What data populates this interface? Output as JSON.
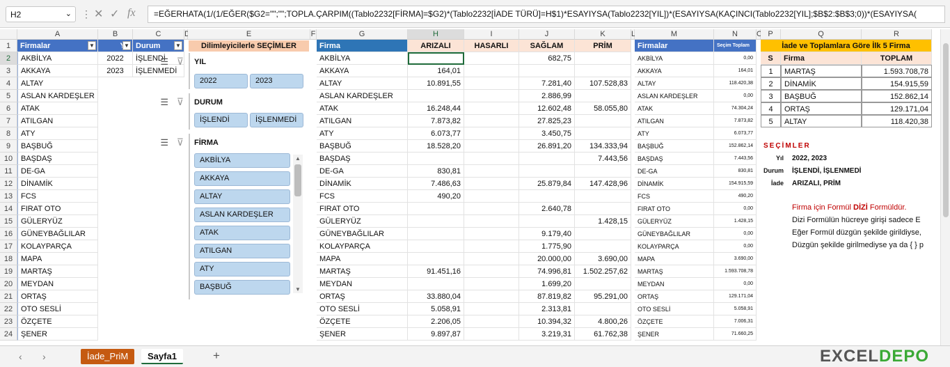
{
  "namebox": "H2",
  "formula": "=EĞERHATA(1/(1/EĞER($G2=\"\";\"\";TOPLA.ÇARPIM((Tablo2232[FİRMA]=$G2)*(Tablo2232[İADE TÜRÜ]=H$1)*ESAYIYSA(Tablo2232[YIL])*(ESAYIYSA(KAÇINCI(Tablo2232[YIL];$B$2:$B$3;0))*(ESAYIYSA(",
  "columns": [
    "A",
    "B",
    "C",
    "D",
    "E",
    "F",
    "G",
    "H",
    "I",
    "J",
    "K",
    "L",
    "M",
    "N",
    "O",
    "P",
    "Q",
    "R"
  ],
  "rows": [
    "1",
    "2",
    "3",
    "4",
    "5",
    "6",
    "7",
    "8",
    "9",
    "10",
    "11",
    "12",
    "13",
    "14",
    "15",
    "16",
    "17",
    "18",
    "19",
    "20",
    "21",
    "22",
    "23",
    "24"
  ],
  "tableA": {
    "header": "Firmalar",
    "items": [
      "AKBİLYA",
      "AKKAYA",
      "ALTAY",
      "ASLAN KARDEŞLER",
      "ATAK",
      "ATILGAN",
      "ATY",
      "BAŞBUĞ",
      "BAŞDAŞ",
      "DE-GA",
      "DİNAMİK",
      "FCS",
      "FIRAT OTO",
      "GÜLERYÜZ",
      "GÜNEYBAĞLILAR",
      "KOLAYPARÇA",
      "MAPA",
      "MARTAŞ",
      "MEYDAN",
      "ORTAŞ",
      "OTO SESLİ",
      "ÖZÇETE",
      "ŞENER"
    ]
  },
  "tableB": {
    "header": "Yıl",
    "items": [
      "2022",
      "2023"
    ]
  },
  "tableC": {
    "header": "Durum",
    "items": [
      "İŞLENDİ",
      "İŞLENMEDİ"
    ]
  },
  "slicer": {
    "header": "Dilimleyicilerle SEÇİMLER",
    "yil": {
      "title": "YIL",
      "items": [
        "2022",
        "2023"
      ]
    },
    "durum": {
      "title": "DURUM",
      "items": [
        "İŞLENDİ",
        "İŞLENMEDİ"
      ]
    },
    "firma": {
      "title": "FİRMA",
      "items": [
        "AKBİLYA",
        "AKKAYA",
        "ALTAY",
        "ASLAN KARDEŞLER",
        "ATAK",
        "ATILGAN",
        "ATY",
        "BAŞBUĞ"
      ]
    }
  },
  "mainTable": {
    "headers": [
      "Firma",
      "ARIZALI",
      "HASARLI",
      "SAĞLAM",
      "PRİM"
    ],
    "rows": [
      [
        "AKBİLYA",
        "",
        "",
        "682,75",
        ""
      ],
      [
        "AKKAYA",
        "164,01",
        "",
        "",
        ""
      ],
      [
        "ALTAY",
        "10.891,55",
        "",
        "7.281,40",
        "107.528,83"
      ],
      [
        "ASLAN KARDEŞLER",
        "",
        "",
        "2.886,99",
        ""
      ],
      [
        "ATAK",
        "16.248,44",
        "",
        "12.602,48",
        "58.055,80"
      ],
      [
        "ATILGAN",
        "7.873,82",
        "",
        "27.825,23",
        ""
      ],
      [
        "ATY",
        "6.073,77",
        "",
        "3.450,75",
        ""
      ],
      [
        "BAŞBUĞ",
        "18.528,20",
        "",
        "26.891,20",
        "134.333,94"
      ],
      [
        "BAŞDAŞ",
        "",
        "",
        "",
        "7.443,56"
      ],
      [
        "DE-GA",
        "830,81",
        "",
        "",
        ""
      ],
      [
        "DİNAMİK",
        "7.486,63",
        "",
        "25.879,84",
        "147.428,96"
      ],
      [
        "FCS",
        "490,20",
        "",
        "",
        ""
      ],
      [
        "FIRAT OTO",
        "",
        "",
        "2.640,78",
        ""
      ],
      [
        "GÜLERYÜZ",
        "",
        "",
        "",
        "1.428,15"
      ],
      [
        "GÜNEYBAĞLILAR",
        "",
        "",
        "9.179,40",
        ""
      ],
      [
        "KOLAYPARÇA",
        "",
        "",
        "1.775,90",
        ""
      ],
      [
        "MAPA",
        "",
        "",
        "20.000,00",
        "3.690,00"
      ],
      [
        "MARTAŞ",
        "91.451,16",
        "",
        "74.996,81",
        "1.502.257,62"
      ],
      [
        "MEYDAN",
        "",
        "",
        "1.699,20",
        ""
      ],
      [
        "ORTAŞ",
        "33.880,04",
        "",
        "87.819,82",
        "95.291,00"
      ],
      [
        "OTO SESLİ",
        "5.058,91",
        "",
        "2.313,81",
        ""
      ],
      [
        "ÖZÇETE",
        "2.206,05",
        "",
        "10.394,32",
        "4.800,26"
      ],
      [
        "ŞENER",
        "9.897,87",
        "",
        "3.219,31",
        "61.762,38"
      ]
    ]
  },
  "totalsTable": {
    "headers": [
      "Firmalar",
      "Seçim Toplam"
    ],
    "rows": [
      [
        "AKBİLYA",
        "0,00"
      ],
      [
        "AKKAYA",
        "164,01"
      ],
      [
        "ALTAY",
        "118.420,38"
      ],
      [
        "ASLAN KARDEŞLER",
        "0,00"
      ],
      [
        "ATAK",
        "74.304,24"
      ],
      [
        "ATILGAN",
        "7.873,82"
      ],
      [
        "ATY",
        "6.073,77"
      ],
      [
        "BAŞBUĞ",
        "152.862,14"
      ],
      [
        "BAŞDAŞ",
        "7.443,56"
      ],
      [
        "DE-GA",
        "830,81"
      ],
      [
        "DİNAMİK",
        "154.915,59"
      ],
      [
        "FCS",
        "490,20"
      ],
      [
        "FIRAT OTO",
        "0,00"
      ],
      [
        "GÜLERYÜZ",
        "1.428,15"
      ],
      [
        "GÜNEYBAĞLILAR",
        "0,00"
      ],
      [
        "KOLAYPARÇA",
        "0,00"
      ],
      [
        "MAPA",
        "3.690,00"
      ],
      [
        "MARTAŞ",
        "1.593.708,78"
      ],
      [
        "MEYDAN",
        "0,00"
      ],
      [
        "ORTAŞ",
        "129.171,04"
      ],
      [
        "OTO SESLİ",
        "5.058,91"
      ],
      [
        "ÖZÇETE",
        "7.006,31"
      ],
      [
        "ŞENER",
        "71.660,25"
      ]
    ]
  },
  "top5": {
    "title": "İade ve Toplamlara Göre İlk 5 Firma",
    "headers": [
      "S",
      "Firma",
      "TOPLAM"
    ],
    "rows": [
      [
        "1",
        "MARTAŞ",
        "1.593.708,78"
      ],
      [
        "2",
        "DİNAMİK",
        "154.915,59"
      ],
      [
        "3",
        "BAŞBUĞ",
        "152.862,14"
      ],
      [
        "4",
        "ORTAŞ",
        "129.171,04"
      ],
      [
        "5",
        "ALTAY",
        "118.420,38"
      ]
    ]
  },
  "secimler": {
    "title": "SEÇİMLER",
    "labels": [
      "Yıl",
      "Durum",
      "İade"
    ],
    "values": [
      "2022, 2023",
      "İŞLENDİ, İŞLENMEDİ",
      "ARIZALI, PRİM"
    ]
  },
  "notes": {
    "line1a": "Firma için Formül ",
    "line1b": "DİZİ",
    "line1c": " Formüldür.",
    "line2": "Dizi Formülün hücreye girişi sadece E",
    "line3": "Eğer Formül düzgün şekilde girildiyse,",
    "line4": "Düzgün şekilde girilmediyse ya da { } p"
  },
  "sheets": [
    "İade_PriM",
    "Sayfa1"
  ],
  "logo": "EXCELDEPO",
  "colors": {
    "tableHeader": "#4472c4",
    "slicerHeader": "#f8cbad",
    "top5Header": "#ffc000",
    "notes": "#c00000"
  }
}
